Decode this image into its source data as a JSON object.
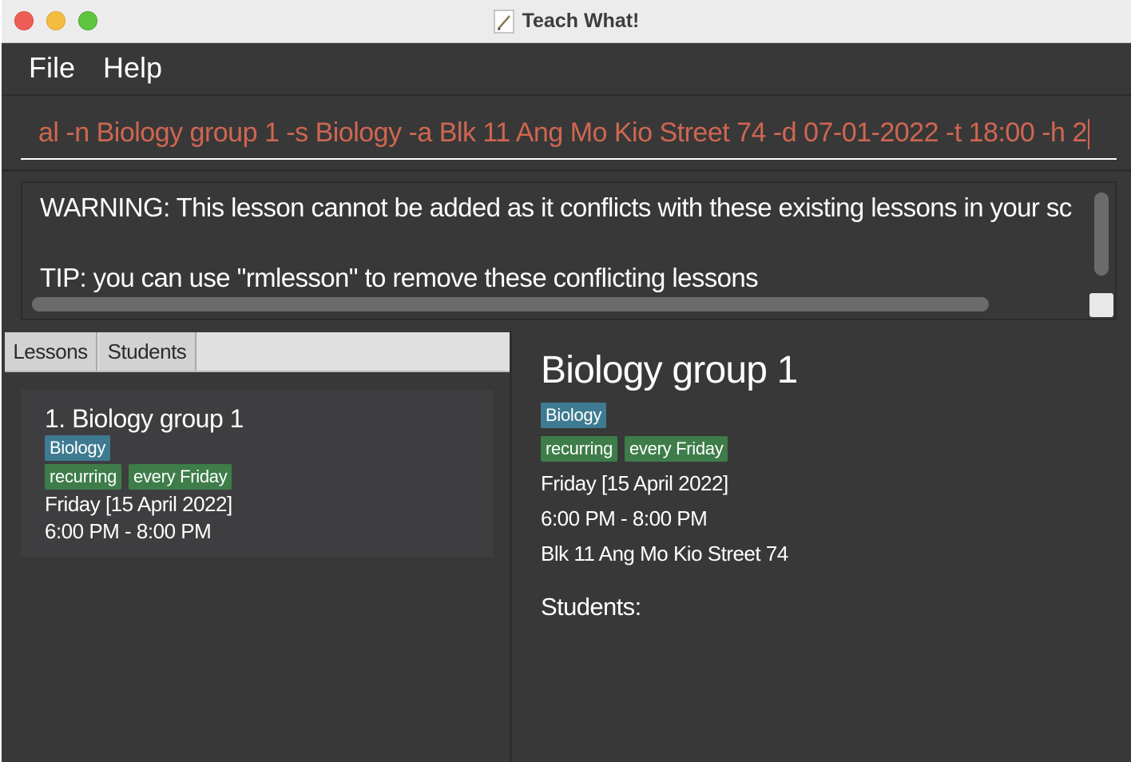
{
  "window": {
    "title": "Teach What!"
  },
  "menu": {
    "file": "File",
    "help": "Help"
  },
  "command": {
    "value": "al -n Biology group 1 -s Biology -a Blk 11 Ang Mo Kio Street 74 -d 07-01-2022 -t 18:00 -h 2"
  },
  "result": {
    "warning": "WARNING: This lesson cannot be added as it conflicts with these existing lessons in your sc",
    "tip": "TIP: you can use \"rmlesson\" to remove these conflicting lessons"
  },
  "tabs": {
    "lessons": "Lessons",
    "students": "Students"
  },
  "lesson_list": [
    {
      "index_title": "1.  Biology group 1",
      "subject": "Biology",
      "recurring": "recurring",
      "frequency": "every Friday",
      "date": "Friday [15 April 2022]",
      "time": "6:00 PM - 8:00 PM"
    }
  ],
  "detail": {
    "title": "Biology group 1",
    "subject": "Biology",
    "recurring": "recurring",
    "frequency": "every Friday",
    "date": "Friday [15 April 2022]",
    "time": "6:00 PM - 8:00 PM",
    "address": "Blk 11 Ang Mo Kio Street 74",
    "students_heading": "Students:"
  },
  "colors": {
    "background": "#383838",
    "command_text": "#d06651",
    "subject_tag": "#3e7b91",
    "green_tag": "#3e7d4a"
  }
}
